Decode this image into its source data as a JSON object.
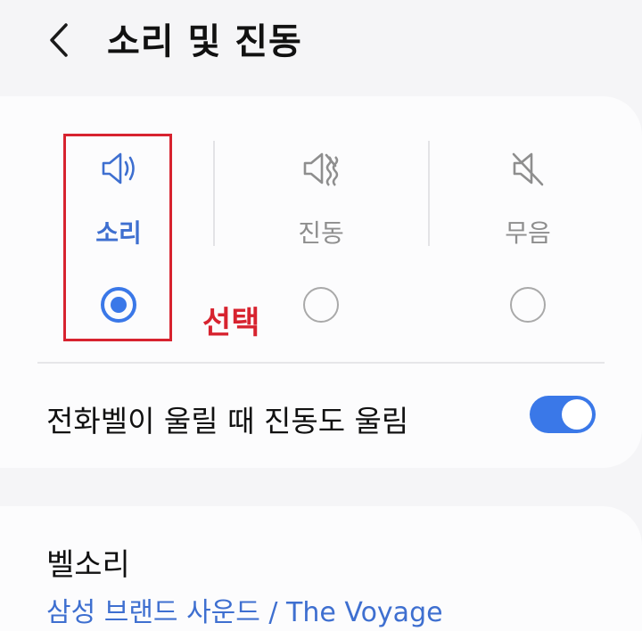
{
  "header": {
    "title": "소리 및 진동",
    "back_icon": "chevron-left-icon"
  },
  "modes": {
    "sound": {
      "label": "소리",
      "icon": "speaker-sound-icon",
      "selected": true
    },
    "vibrate": {
      "label": "진동",
      "icon": "speaker-vibrate-icon",
      "selected": false
    },
    "mute": {
      "label": "무음",
      "icon": "speaker-mute-icon",
      "selected": false
    }
  },
  "annotation": {
    "text": "선택",
    "color": "#d7232f"
  },
  "vibrate_while_ringing": {
    "label": "전화벨이 울릴 때 진동도 울림",
    "enabled": true
  },
  "ringtone": {
    "title": "벨소리",
    "value": "삼성 브랜드 사운드 / The Voyage"
  },
  "colors": {
    "accent": "#3a78e8",
    "active_label": "#3e6fd0",
    "annotation": "#d7232f"
  }
}
